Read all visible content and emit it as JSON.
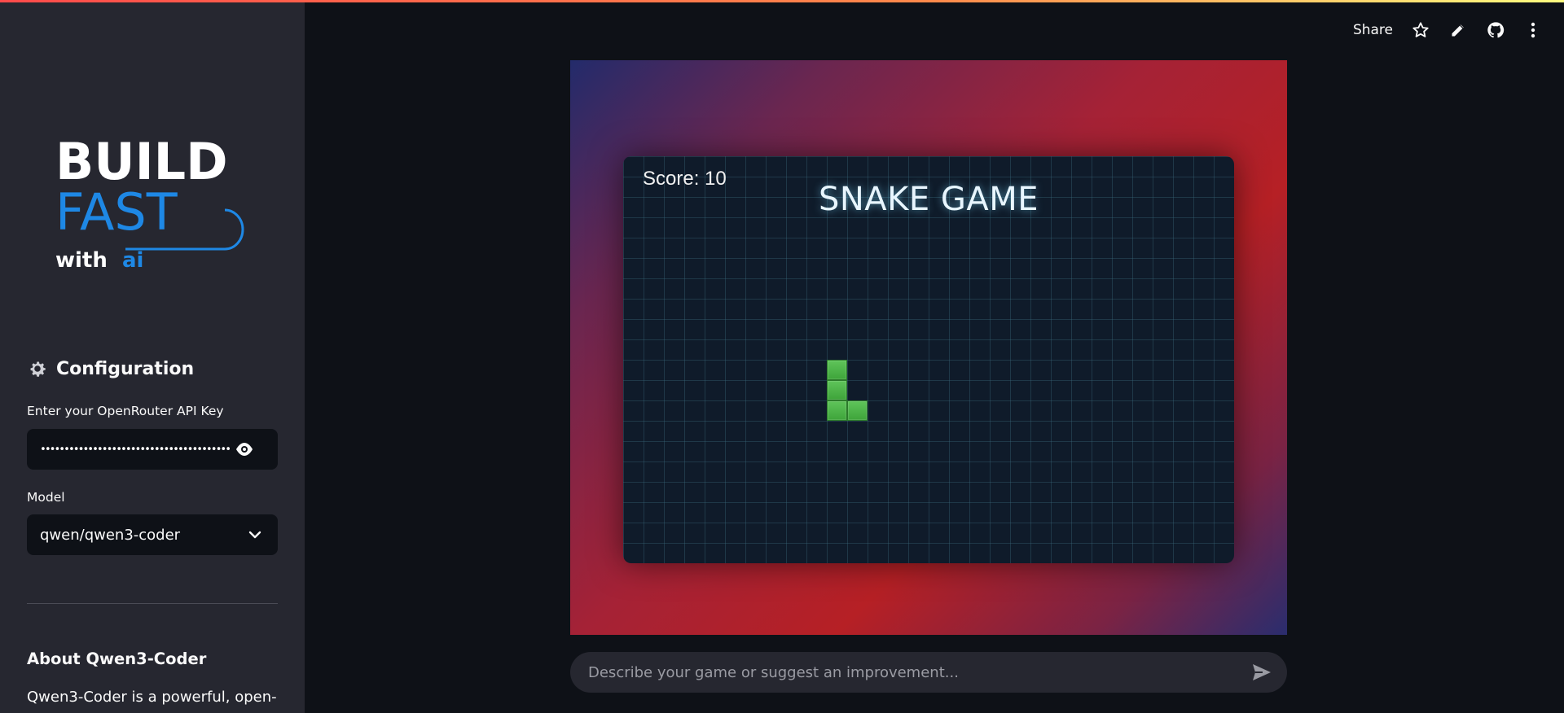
{
  "header": {
    "share_label": "Share",
    "icons": [
      "star-icon",
      "edit-icon",
      "github-icon",
      "more-vertical-icon"
    ]
  },
  "sidebar": {
    "logo": {
      "line1": "BUILD",
      "line2": "FAST",
      "line3_prefix": "with",
      "line3_suffix": "ai",
      "colors": {
        "white": "#ffffff",
        "blue": "#1e88e5"
      }
    },
    "config_title": "Configuration",
    "api_key_label": "Enter your OpenRouter API Key",
    "api_key_value": "••••••••••••••••••••••••••••••••••••••••",
    "model_label": "Model",
    "model_value": "qwen/qwen3-coder",
    "about_title": "About Qwen3-Coder",
    "about_text": "Qwen3-Coder is a powerful, open-"
  },
  "game": {
    "score_text": "Score: 10",
    "title": "SNAKE GAME",
    "colors": {
      "board": "#0f1b2a",
      "snake": "#4caf50",
      "grid": "#2c5566"
    }
  },
  "chat": {
    "placeholder": "Describe your game or suggest an improvement..."
  },
  "theme": {
    "app_bg": "#0e1117",
    "sidebar_bg": "#262730",
    "accent_stripe": "#ff4b4b"
  }
}
